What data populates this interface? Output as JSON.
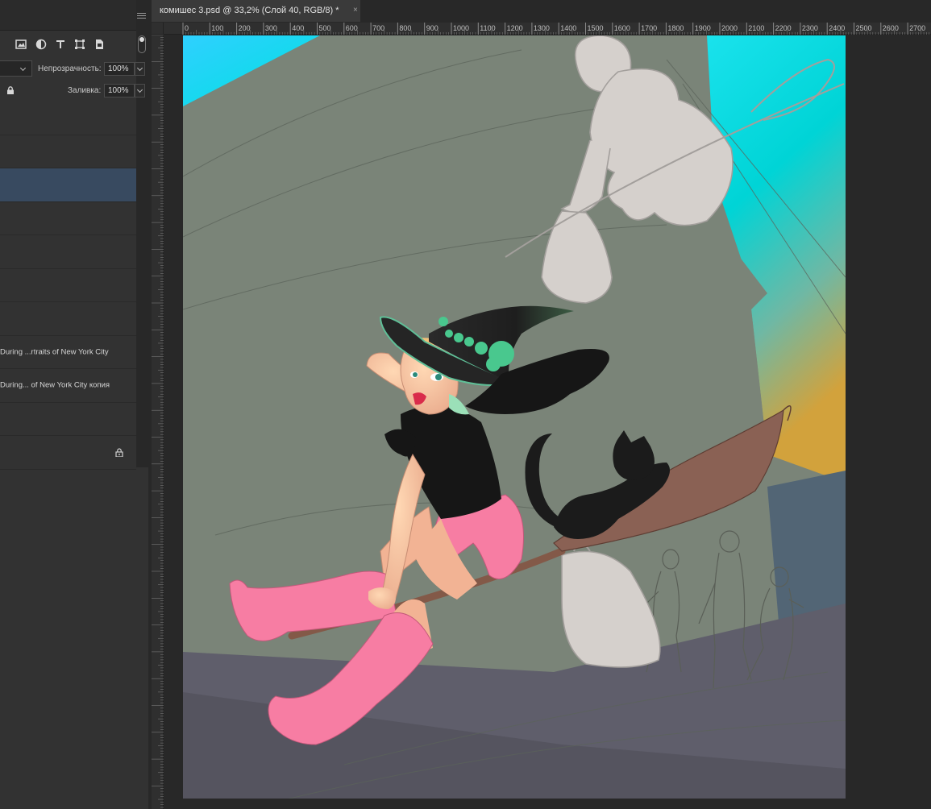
{
  "panel": {
    "opacity_label": "Непрозрачность:",
    "opacity_value": "100%",
    "fill_label": "Заливка:",
    "fill_value": "100%",
    "filter_icons": [
      "image-filter-icon",
      "adjustment-filter-icon",
      "type-filter-icon",
      "shape-filter-icon",
      "smart-object-filter-icon"
    ],
    "layers": [
      {
        "label": "",
        "selected": false
      },
      {
        "label": "",
        "selected": false
      },
      {
        "label": "",
        "selected": true
      },
      {
        "label": "",
        "selected": false
      },
      {
        "label": "",
        "selected": false
      },
      {
        "label": "",
        "selected": false
      },
      {
        "label": "",
        "selected": false
      },
      {
        "label": "During ...rtraits of New York City",
        "selected": false
      },
      {
        "label": "During... of New York City копия",
        "selected": false
      },
      {
        "label": "",
        "selected": false
      },
      {
        "label": "",
        "selected": false,
        "locked": true
      }
    ]
  },
  "document": {
    "tab_title": "комишес 3.psd @ 33,2% (Слой 40, RGB/8) *",
    "close_symbol": "×"
  },
  "ruler": {
    "h_labels": [
      "0",
      "100",
      "200",
      "300",
      "400",
      "500",
      "600",
      "700",
      "800",
      "900",
      "1000",
      "1100",
      "1200",
      "1300",
      "1400",
      "1500",
      "1600",
      "1700",
      "1800",
      "1900",
      "2000",
      "2100",
      "2200",
      "2300",
      "2400",
      "2500",
      "2600",
      "2700"
    ]
  },
  "colors": {
    "ui_bg": "#282828",
    "panel_bg": "#323232",
    "selected_layer": "#384a60",
    "wall": "#7a8478",
    "sky": "#00d8d8",
    "street": "#5a5966",
    "boots_shorts": "#f77da3"
  }
}
